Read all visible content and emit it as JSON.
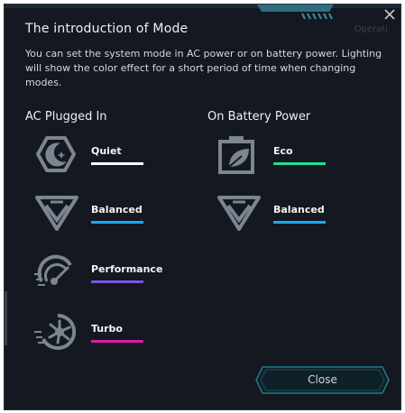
{
  "dialog": {
    "ghost_text": "Operati",
    "title": "The introduction of Mode",
    "description": "You can set the system mode in AC power or on battery power. Lighting will show the color effect for a short period of time when changing modes."
  },
  "columns": {
    "ac": {
      "heading": "AC Plugged In",
      "modes": [
        {
          "label": "Quiet",
          "icon": "quiet-moon-icon",
          "color": "#ffffff"
        },
        {
          "label": "Balanced",
          "icon": "balanced-chevron-icon",
          "color": "#1ea7f0"
        },
        {
          "label": "Performance",
          "icon": "performance-gauge-icon",
          "color": "#7a55e0"
        },
        {
          "label": "Turbo",
          "icon": "turbo-fan-icon",
          "color": "#e01aa8"
        }
      ]
    },
    "battery": {
      "heading": "On Battery Power",
      "modes": [
        {
          "label": "Eco",
          "icon": "eco-leaf-battery-icon",
          "color": "#1ee08c"
        },
        {
          "label": "Balanced",
          "icon": "balanced-chevron-icon",
          "color": "#1ea7f0"
        }
      ]
    }
  },
  "buttons": {
    "close_label": "Close"
  },
  "colors": {
    "background": "#141820",
    "accent": "#1e7a8a",
    "icon_gray": "#7d8590"
  }
}
